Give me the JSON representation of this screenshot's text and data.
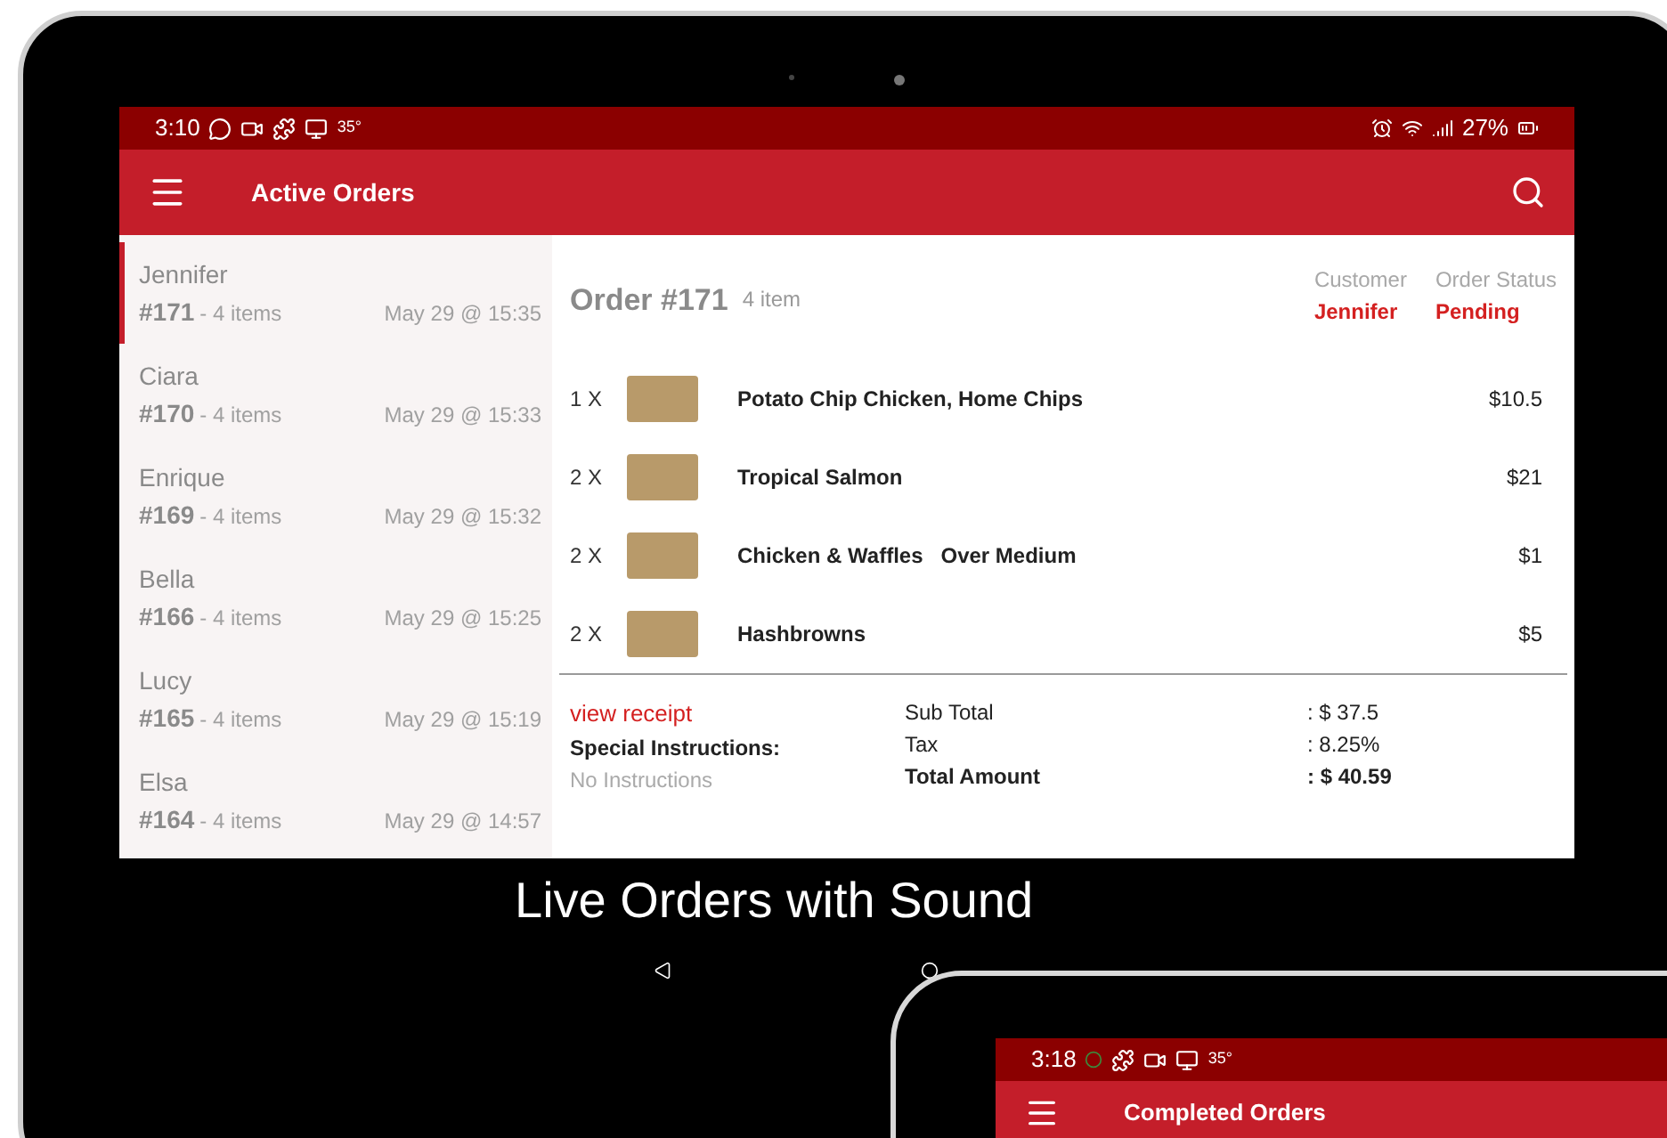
{
  "main_screen": {
    "status_bar": {
      "time": "3:10",
      "temperature": "35°",
      "battery": "27%"
    },
    "app_bar": {
      "title": "Active Orders"
    },
    "orders": [
      {
        "name": "Jennifer",
        "number": "#171",
        "items": "- 4 items",
        "time": "May 29 @ 15:35",
        "selected": true
      },
      {
        "name": "Ciara",
        "number": "#170",
        "items": "- 4 items",
        "time": "May 29 @ 15:33",
        "selected": false
      },
      {
        "name": "Enrique",
        "number": "#169",
        "items": "- 4 items",
        "time": "May 29 @ 15:32",
        "selected": false
      },
      {
        "name": "Bella",
        "number": "#166",
        "items": "- 4 items",
        "time": "May 29 @ 15:25",
        "selected": false
      },
      {
        "name": "Lucy",
        "number": "#165",
        "items": "- 4 items",
        "time": "May 29 @ 15:19",
        "selected": false
      },
      {
        "name": "Elsa",
        "number": "#164",
        "items": "- 4 items",
        "time": "May 29 @ 14:57",
        "selected": false
      }
    ],
    "order_detail": {
      "title": "Order #171",
      "count": "4 item",
      "customer_label": "Customer",
      "customer": "Jennifer",
      "status_label": "Order Status",
      "status": "Pending",
      "lines": [
        {
          "qty": "1 X",
          "name": "Potato Chip Chicken, Home Chips",
          "price": "$10.5"
        },
        {
          "qty": "2 X",
          "name": "Tropical Salmon",
          "price": "$21"
        },
        {
          "qty": "2 X",
          "name": "Chicken & Waffles   Over Medium",
          "price": "$1"
        },
        {
          "qty": "2 X",
          "name": "Hashbrowns",
          "price": "$5"
        }
      ],
      "receipt_link": "view receipt",
      "instructions_label": "Special Instructions:",
      "instructions": "No Instructions",
      "totals": [
        {
          "label": "Sub Total",
          "value": ": $ 37.5",
          "bold": false
        },
        {
          "label": "Tax",
          "value": ": 8.25%",
          "bold": false
        },
        {
          "label": "Total Amount",
          "value": ": $ 40.59",
          "bold": true
        }
      ]
    }
  },
  "caption": "Live Orders with Sound",
  "second_screen": {
    "status_bar": {
      "time": "3:18",
      "temperature": "35°"
    },
    "app_bar": {
      "title": "Completed Orders"
    }
  }
}
